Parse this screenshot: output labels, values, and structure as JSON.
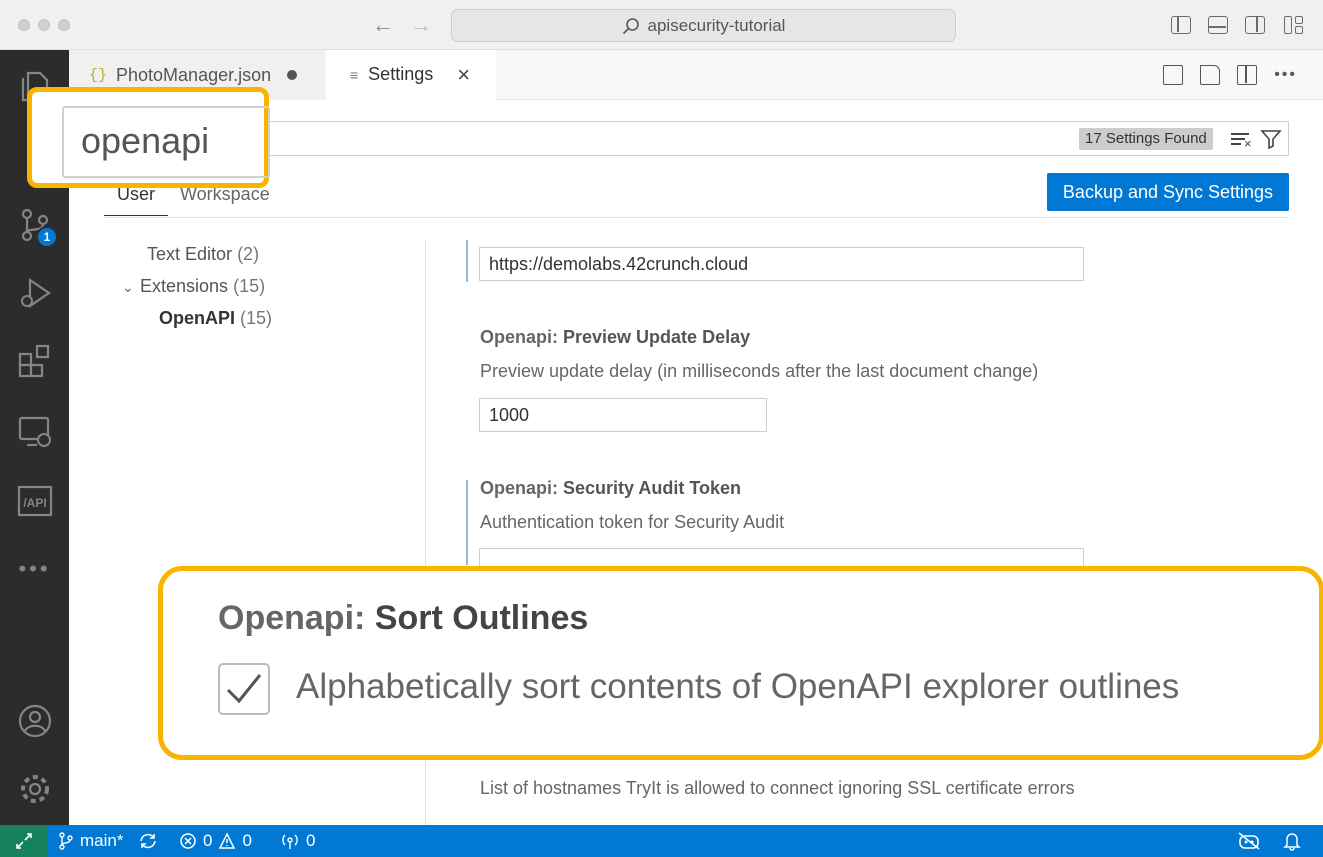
{
  "titlebar": {
    "search_text": "apisecurity-tutorial"
  },
  "activity": {
    "scm_badge": "1"
  },
  "tabs": [
    {
      "label": "PhotoManager.json"
    },
    {
      "label": "Settings"
    }
  ],
  "settings_search": {
    "value": "openapi",
    "found": "17 Settings Found"
  },
  "scope": {
    "user": "User",
    "workspace": "Workspace",
    "sync_button": "Backup and Sync Settings"
  },
  "toc": [
    {
      "label": "Text Editor",
      "count": "(2)"
    },
    {
      "label": "Extensions",
      "count": "(15)"
    },
    {
      "label": "OpenAPI",
      "count": "(15)"
    }
  ],
  "settings": {
    "url_value": "https://demolabs.42crunch.cloud",
    "preview": {
      "category": "Openapi: ",
      "title": "Preview Update Delay",
      "desc": "Preview update delay (in milliseconds after the last document change)",
      "value": "1000"
    },
    "token": {
      "category": "Openapi: ",
      "title": "Security Audit Token",
      "desc": "Authentication token for Security Audit"
    },
    "tryit": {
      "desc": "List of hostnames TryIt is allowed to connect ignoring SSL certificate errors"
    }
  },
  "callout": {
    "category": "Openapi: ",
    "title": "Sort Outlines",
    "desc": "Alphabetically sort contents of OpenAPI explorer outlines",
    "checked": true
  },
  "statusbar": {
    "branch": "main*",
    "errors": "0",
    "warnings": "0",
    "ports": "0"
  },
  "colors": {
    "accent": "#0078d4",
    "callout": "#f7b500",
    "remote": "#16825d"
  }
}
